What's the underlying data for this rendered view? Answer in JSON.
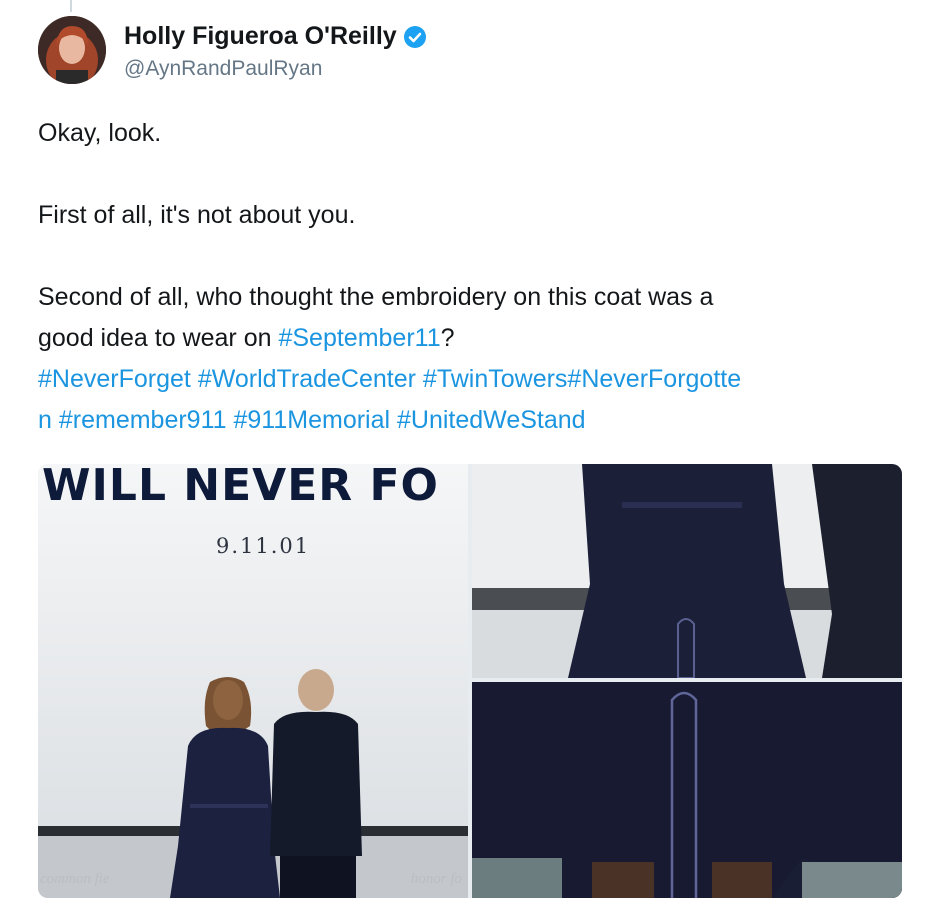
{
  "tweet": {
    "author": {
      "display_name": "Holly Figueroa O'Reilly",
      "handle": "@AynRandPaulRyan",
      "verified": true,
      "verified_icon": "verified-badge-icon"
    },
    "paragraphs": [
      "Okay, look.",
      "First of all, it's not about you.",
      "Second of all, who thought the embroidery on this coat was a"
    ],
    "line4_text": "good idea to wear on ",
    "line4_hashtag": "#September11",
    "line4_end": "?",
    "hashtags_line5": [
      "#NeverForget",
      "#WorldTradeCenter",
      "#TwinTowers",
      "#NeverForgotte"
    ],
    "line6_fragment": "n",
    "hashtags_line6": [
      "#remember911",
      "#911Memorial",
      "#UnitedWeStand"
    ],
    "colors": {
      "link": "#1b95e0",
      "name": "#14171a",
      "handle": "#657786"
    }
  },
  "media": {
    "left": {
      "banner_title": "WILL NEVER FO",
      "banner_date": "9.11.01",
      "wall_text_left": "common fie",
      "wall_text_right": "honor fo"
    }
  }
}
